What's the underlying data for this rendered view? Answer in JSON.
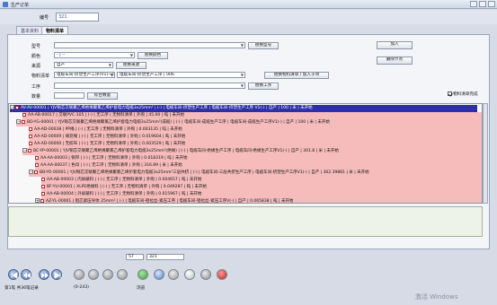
{
  "window": {
    "title": "生产订单"
  },
  "header": {
    "id_label": "编号",
    "id_value": "321"
  },
  "tabs": [
    {
      "label": "基本资料"
    },
    {
      "label": "物料清单"
    }
  ],
  "form": {
    "model": {
      "label": "型号",
      "value": "",
      "btn": "替换型号"
    },
    "color": {
      "label": "颜色",
      "value": "- | --",
      "btn": "替换颜色"
    },
    "source": {
      "label": "来源",
      "value": "自产",
      "btn": "替换来源"
    },
    "bom": {
      "label": "物料清单",
      "value1": "电缆车间-挤塑生产工序(V1(一)",
      "value2": "电缆车间-挤塑生产工序 | 006",
      "btn": "替换物料清单 / 加入子项"
    },
    "process": {
      "label": "工序",
      "value": "",
      "btn": "替换工序"
    },
    "quantity": {
      "label": "数量",
      "value": "",
      "btn": "综合数量"
    }
  },
  "right_buttons": {
    "add": "加入",
    "delete": "删除节点"
  },
  "checkbox": {
    "label": "物料清单完成",
    "checked": true
  },
  "tree_rows": [
    {
      "text": "AV-AV-00001 | YJV铜芯交联聚乙烯绝缘聚氯乙烯护套电力电缆3x25mm² | (-) | 电缆车间-挤塑生产工序 | 电缆车间-挤塑生产工序 V1(-) | 自产 | 100 | 米 | 未开始",
      "toggle": "−"
    },
    {
      "text": "AA-AB-00017 | 交联PVC-105 | (-) | 无工序 | 无物料清单 | 外购 | 45.00 | 吨 | 未开始",
      "toggle": ""
    },
    {
      "text": "BD-YG-00001 | YJV铜芯交联聚乙烯绝缘聚氯乙烯护套电力电缆3x25mm²(成缆) | (-) | 电缆车间-成缆生产工序 | 电缆车间-成缆生产工序V1(-) | 自产 | 100 | 米 | 未开始",
      "toggle": "−"
    },
    {
      "text": "AA-AD-00038 | PP绳 | (-) | 无工序 | 无物料清单 | 外购 | 0.003135 | 吨 | 未开始",
      "toggle": ""
    },
    {
      "text": "AA-AD-00009 | 填充绳 | (-) | 无工序 | 无物料清单 | 外购 | 0.019604 | 吨 | 未开始",
      "toggle": ""
    },
    {
      "text": "AA-AD-00000 | 无纺布 | (-) | 无工序 | 无物料清单 | 外购 | 0.003529 | 吨 | 未开始",
      "toggle": ""
    },
    {
      "text": "BC-YP-00001 | YJV铜芯交联聚乙烯绝缘聚氯乙烯护套电力电缆3x25mm²(绝缘) | (-) | 电缆车间-绝缘生产工序 | 电缆车间-绝缘生产工序V1(-) | 自产 | 301.8 | 米 | 未开始",
      "toggle": "−"
    },
    {
      "text": "AA-AA-00003 | 铜带 | (-) | 无工序 | 无物料清单 | 外购 | 0.018319 | 吨 | 未开始",
      "toggle": ""
    },
    {
      "text": "AA-AA-00037 | 色母 | (-) | 无工序 | 无物料清单 | 外购 | 316.89 | 米 | 未开始",
      "toggle": ""
    },
    {
      "text": "BB-YO-00001 | YJV铜芯交联聚乙烯绝缘聚氯乙烯护套电力电缆3x25mm²三层共挤 | (-) | 电缆车间-三层共挤生产工序 | 电缆车间-挤塑生产工序V1(-) | 自产 | 302.39881 | 米 | 未开始",
      "toggle": "−"
    },
    {
      "text": "AA-AB-00003 | 内屏蔽料 | (-) | 无工序 | 无物料清单 | 外购 | 0.004657 | 吨 | 未开始",
      "toggle": ""
    },
    {
      "text": "BF-YU-00001 | XLPE绝缘料 | (-) | 无工序 | 无物料清单 | 外购 | 0.049287 | 吨 | 未开始",
      "toggle": ""
    },
    {
      "text": "AA-AB-00004 | 外屏蔽料 | (-) | 无工序 | 无物料清单 | 外购 | 0.015967 | 吨 | 未开始",
      "toggle": ""
    },
    {
      "text": "AZ-YL-00001 | 铝芯紧压导体 25mm² | (-) | 电缆车间-铝拉丝-紧压工序 | 电缆车间-铝拉丝-紧压工序V(-) | 自产 | 0.065838 | 吨 | 未开始",
      "toggle": "+"
    }
  ],
  "pager": {
    "value1": "57",
    "value2": "321"
  },
  "footer": {
    "record_info": "第1笔  共36笔记录",
    "count_info": "(0-243)",
    "browse_label": "浏览"
  },
  "watermark": "激活 Windows"
}
